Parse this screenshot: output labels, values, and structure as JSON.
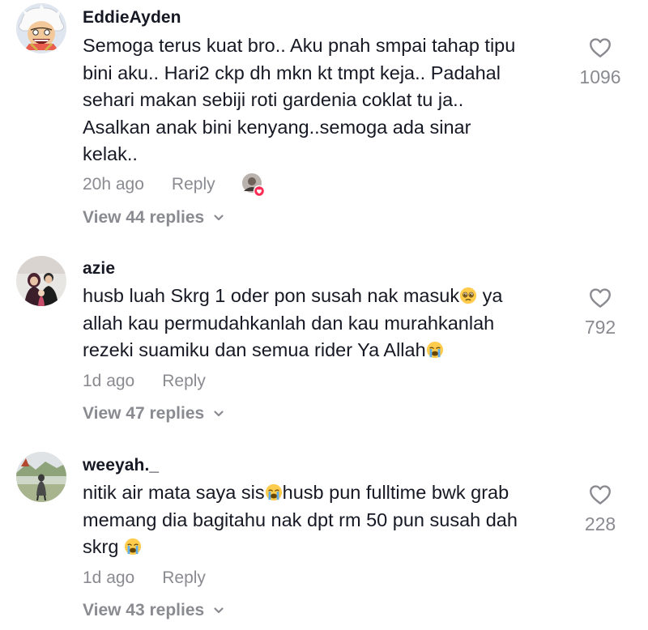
{
  "comments": [
    {
      "username": "EddieAyden",
      "text_lines": [
        "Semoga terus kuat bro.. Aku pnah smpai tahap tipu",
        "bini aku.. Hari2 ckp dh mkn kt tmpt keja.. Padahal",
        "sehari makan sebiji roti gardenia coklat tu ja..",
        "Asalkan anak bini kenyang..semoga ada sinar",
        "kelak.."
      ],
      "time": "20h ago",
      "reply_label": "Reply",
      "view_replies": "View 44 replies",
      "likes": "1096",
      "creator_liked": true
    },
    {
      "username": "azie",
      "text_parts": [
        "husb luah Skrg 1 oder pon susah nak masuk",
        " ya",
        "allah kau permudahkanlah dan kau murahkanlah",
        "rezeki suamiku dan semua rider Ya Allah"
      ],
      "time": "1d ago",
      "reply_label": "Reply",
      "view_replies": "View 47 replies",
      "likes": "792"
    },
    {
      "username": "weeyah._",
      "text_parts": [
        "nitik air mata saya sis",
        "husb pun fulltime bwk grab",
        "memang dia bagitahu nak dpt rm 50 pun susah dah",
        "skrg "
      ],
      "time": "1d ago",
      "reply_label": "Reply",
      "view_replies": "View 43 replies",
      "likes": "228"
    }
  ],
  "icons": {
    "like": "heart-outline-icon",
    "expand": "chevron-down-icon",
    "creator_liked_badge": "heart-badge-icon",
    "emoji_pleading": "pleading-face-emoji",
    "emoji_crying": "loudly-crying-face-emoji"
  },
  "colors": {
    "text": "#161823",
    "muted": "#8a8b91",
    "like_badge": "#fe2c55"
  }
}
